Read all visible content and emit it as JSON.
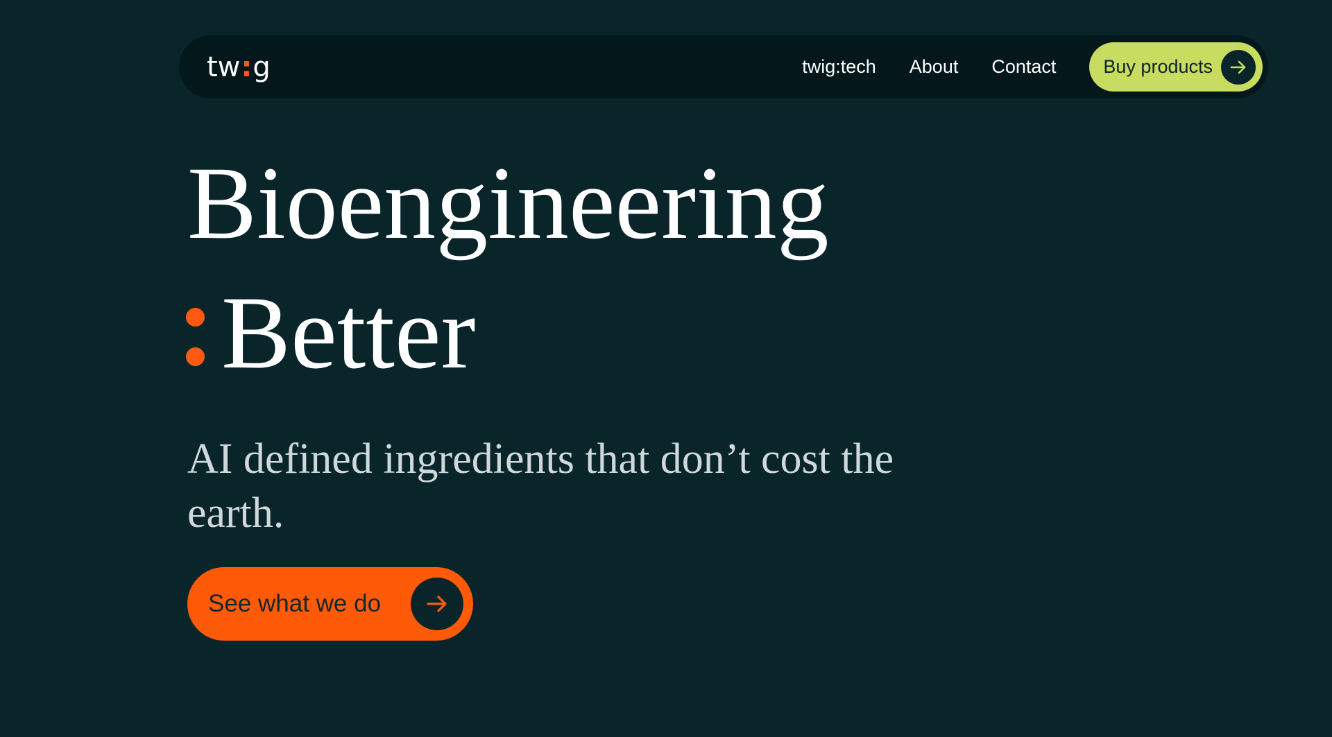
{
  "nav": {
    "logo": {
      "left": "tw",
      "separator": ":",
      "right": "g"
    },
    "links": [
      {
        "label": "twig:tech"
      },
      {
        "label": "About"
      },
      {
        "label": "Contact"
      }
    ],
    "buy_button": {
      "label": "Buy products",
      "icon": "arrow-right-icon"
    }
  },
  "hero": {
    "title_line1": "Bioengineering",
    "title_line2_prefix": ":",
    "title_line2": "Better",
    "subtitle": "AI defined ingredients that don’t cost the earth.",
    "cta": {
      "label": "See what we do",
      "icon": "arrow-right-icon"
    }
  },
  "colors": {
    "background": "#0a252a",
    "navbar": "#04171a",
    "accent_orange": "#ff5a12",
    "accent_lime": "#c8dc5f",
    "text_white": "#ffffff",
    "text_muted": "#cfd8da"
  }
}
